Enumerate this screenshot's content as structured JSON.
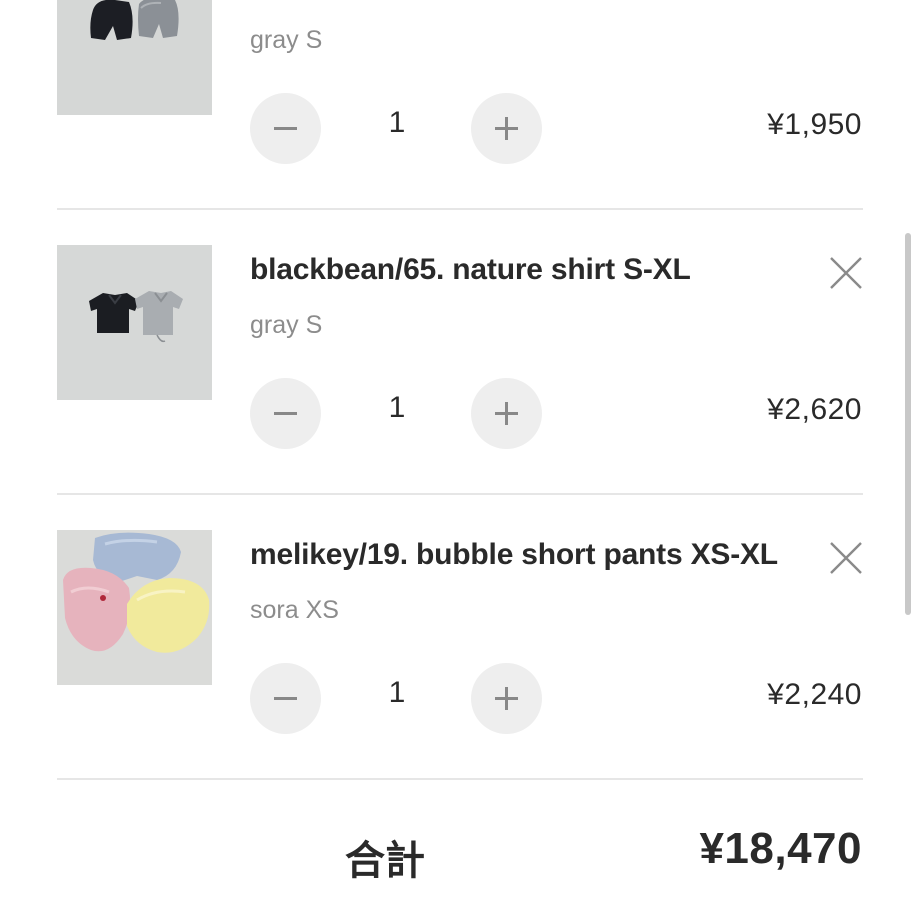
{
  "cart": {
    "items": [
      {
        "name": "",
        "variant": "gray S",
        "quantity": "1",
        "price": "¥1,950",
        "image": "shorts-product-photo"
      },
      {
        "name": "blackbean/65. nature shirt S-XL",
        "variant": "gray S",
        "quantity": "1",
        "price": "¥2,620",
        "image": "shirt-product-photo"
      },
      {
        "name": "melikey/19. bubble short pants XS-XL",
        "variant": "sora XS",
        "quantity": "1",
        "price": "¥2,240",
        "image": "bubble-pants-product-photo"
      }
    ]
  },
  "summary": {
    "total_label": "合計",
    "total_amount": "¥18,470"
  },
  "colors": {
    "text": "#2a2a2a",
    "muted": "#8c8c8c",
    "button_bg": "#eeeeee",
    "divider": "#e6e6e6"
  },
  "icons": {
    "remove": "close-icon",
    "decrement": "minus-icon",
    "increment": "plus-icon"
  }
}
